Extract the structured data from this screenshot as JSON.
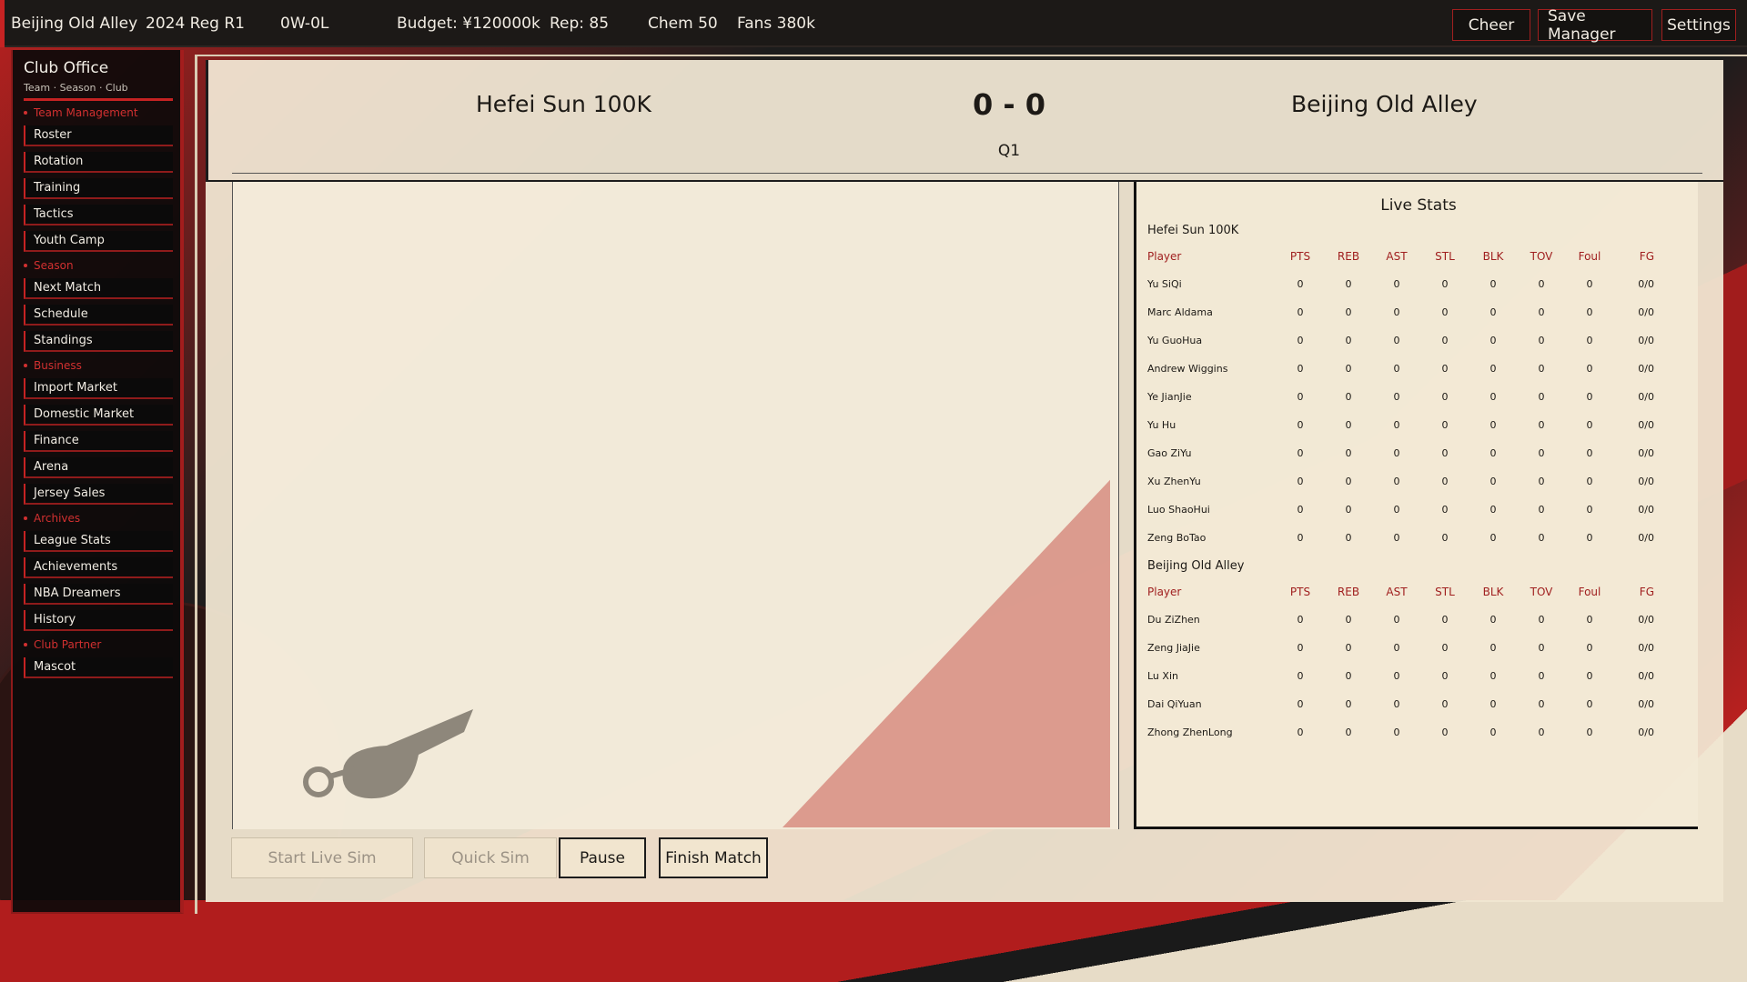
{
  "topbar": {
    "team": "Beijing Old Alley",
    "season": "2024 Reg R1",
    "record": "0W-0L",
    "budget": "Budget: ¥120000k",
    "rep": "Rep: 85",
    "chem": "Chem 50",
    "fans": "Fans 380k",
    "buttons": {
      "cheer": "Cheer",
      "save": "Save Manager",
      "settings": "Settings"
    }
  },
  "sidebar": {
    "title": "Club Office",
    "subtitle": "Team · Season · Club",
    "sections": {
      "team": "Team Management",
      "season": "Season",
      "business": "Business",
      "archives": "Archives",
      "partner": "Club Partner"
    },
    "items": {
      "roster": "Roster",
      "rotation": "Rotation",
      "training": "Training",
      "tactics": "Tactics",
      "youth": "Youth Camp",
      "next_match": "Next Match",
      "schedule": "Schedule",
      "standings": "Standings",
      "import_market": "Import Market",
      "domestic_market": "Domestic Market",
      "finance": "Finance",
      "arena": "Arena",
      "jersey": "Jersey Sales",
      "league_stats": "League Stats",
      "achievements": "Achievements",
      "nba_dreamers": "NBA Dreamers",
      "history": "History",
      "mascot": "Mascot"
    }
  },
  "match": {
    "home": "Hefei Sun 100K",
    "away": "Beijing Old Alley",
    "score": "0 - 0",
    "quarter": "Q1"
  },
  "stats": {
    "title": "Live Stats",
    "columns": [
      "Player",
      "PTS",
      "REB",
      "AST",
      "STL",
      "BLK",
      "TOV",
      "Foul",
      "FG"
    ],
    "home_team": "Hefei Sun 100K",
    "home_players": [
      [
        "Yu SiQi",
        "0",
        "0",
        "0",
        "0",
        "0",
        "0",
        "0",
        "0/0"
      ],
      [
        "Marc Aldama",
        "0",
        "0",
        "0",
        "0",
        "0",
        "0",
        "0",
        "0/0"
      ],
      [
        "Yu GuoHua",
        "0",
        "0",
        "0",
        "0",
        "0",
        "0",
        "0",
        "0/0"
      ],
      [
        "Andrew Wiggins",
        "0",
        "0",
        "0",
        "0",
        "0",
        "0",
        "0",
        "0/0"
      ],
      [
        "Ye JianJie",
        "0",
        "0",
        "0",
        "0",
        "0",
        "0",
        "0",
        "0/0"
      ],
      [
        "Yu Hu",
        "0",
        "0",
        "0",
        "0",
        "0",
        "0",
        "0",
        "0/0"
      ],
      [
        "Gao ZiYu",
        "0",
        "0",
        "0",
        "0",
        "0",
        "0",
        "0",
        "0/0"
      ],
      [
        "Xu ZhenYu",
        "0",
        "0",
        "0",
        "0",
        "0",
        "0",
        "0",
        "0/0"
      ],
      [
        "Luo ShaoHui",
        "0",
        "0",
        "0",
        "0",
        "0",
        "0",
        "0",
        "0/0"
      ],
      [
        "Zeng BoTao",
        "0",
        "0",
        "0",
        "0",
        "0",
        "0",
        "0",
        "0/0"
      ]
    ],
    "away_team": "Beijing Old Alley",
    "away_players": [
      [
        "Du ZiZhen",
        "0",
        "0",
        "0",
        "0",
        "0",
        "0",
        "0",
        "0/0"
      ],
      [
        "Zeng JiaJie",
        "0",
        "0",
        "0",
        "0",
        "0",
        "0",
        "0",
        "0/0"
      ],
      [
        "Lu Xin",
        "0",
        "0",
        "0",
        "0",
        "0",
        "0",
        "0",
        "0/0"
      ],
      [
        "Dai QiYuan",
        "0",
        "0",
        "0",
        "0",
        "0",
        "0",
        "0",
        "0/0"
      ],
      [
        "Zhong ZhenLong",
        "0",
        "0",
        "0",
        "0",
        "0",
        "0",
        "0",
        "0/0"
      ]
    ]
  },
  "controls": {
    "start_live": "Start Live Sim",
    "quick": "Quick Sim",
    "pause": "Pause",
    "finish": "Finish Match"
  }
}
